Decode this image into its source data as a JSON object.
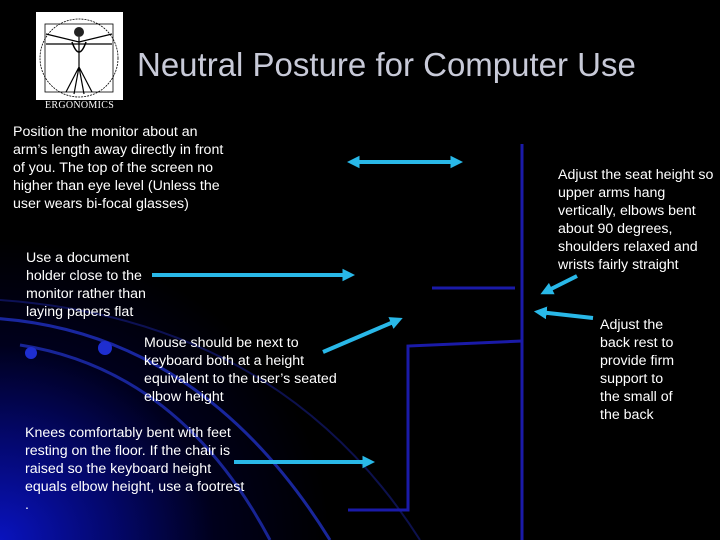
{
  "slide": {
    "title": "Neutral Posture for Computer Use",
    "logo": {
      "icon": "vitruvian-man-icon",
      "caption": "ERGONOMICS"
    },
    "notes": {
      "monitor": "Position the monitor about an arm’s length away directly in front of you.  The top of the screen no higher than eye level (Unless the user wears bi-focal glasses)",
      "document": "Use a document holder close to the monitor rather than laying papers flat",
      "mouse": "Mouse should be next to keyboard both at a height equivalent to the user’s seated elbow height",
      "knees": "Knees comfortably bent with feet resting on the floor.  If the chair is raised so the keyboard height equals elbow height, use a footrest .",
      "seat": "Adjust the seat height so upper arms hang vertically, elbows bent about 90 degrees, shoulders relaxed and wrists fairly straight",
      "back": "Adjust the back rest to provide firm support to the small of the back"
    },
    "colors": {
      "arrow": "#29b8e8",
      "chair": "#1a1aa8",
      "title": "#c8cad8",
      "text": "#ffffff",
      "background": "#000000"
    }
  }
}
